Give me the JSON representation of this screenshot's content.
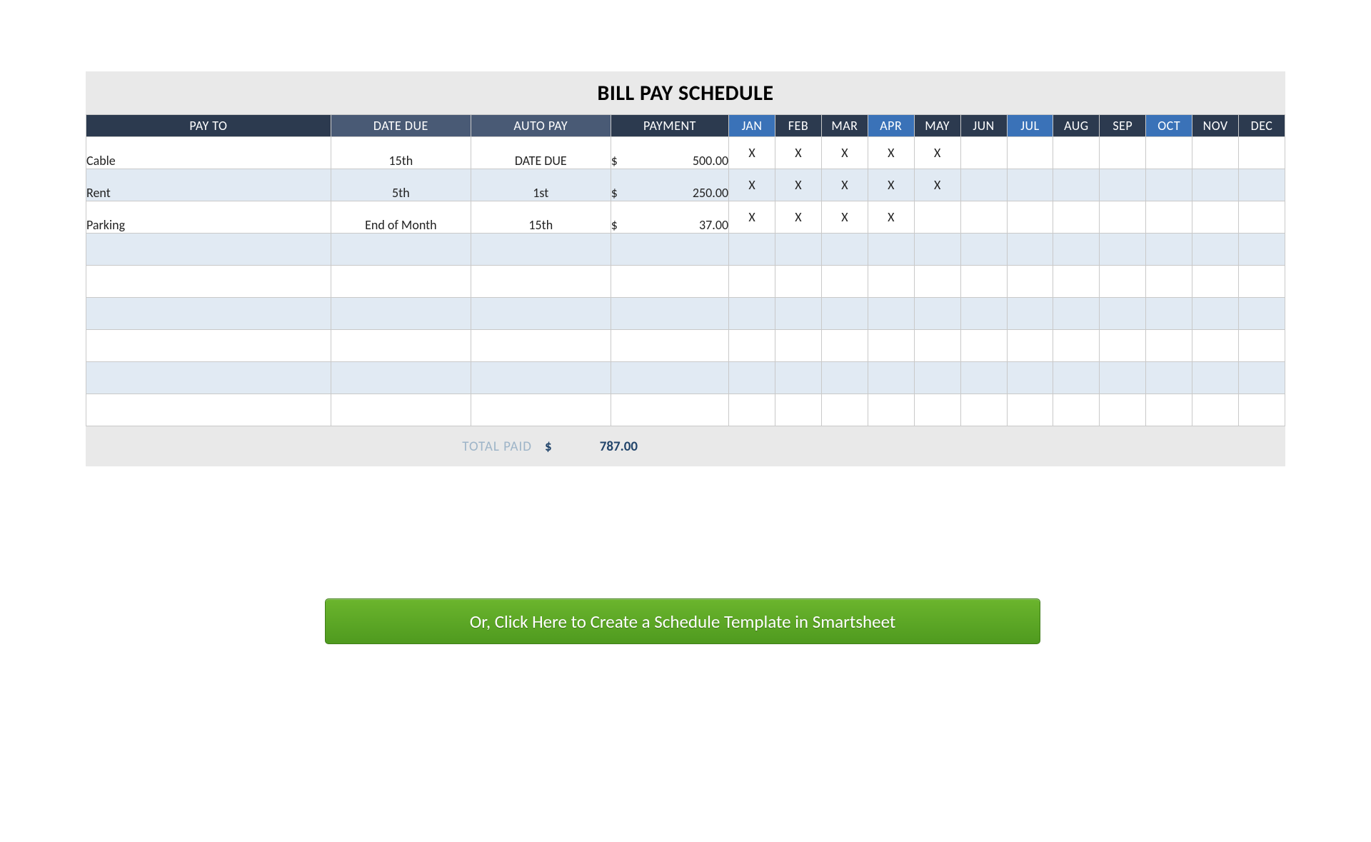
{
  "title": "BILL PAY SCHEDULE",
  "headers": {
    "pay_to": "PAY TO",
    "date_due": "DATE DUE",
    "auto_pay": "AUTO PAY",
    "payment": "PAYMENT"
  },
  "months": [
    "JAN",
    "FEB",
    "MAR",
    "APR",
    "MAY",
    "JUN",
    "JUL",
    "AUG",
    "SEP",
    "OCT",
    "NOV",
    "DEC"
  ],
  "month_colors": [
    "blue",
    "dark2",
    "dark2",
    "blue",
    "dark2",
    "dark2",
    "blue",
    "dark2",
    "dark2",
    "blue",
    "dark2",
    "dark2"
  ],
  "currency": "$",
  "mark": "X",
  "rows": [
    {
      "pay_to": "Cable",
      "date_due": "15th",
      "auto_pay": "DATE DUE",
      "payment": "500.00",
      "marks": [
        true,
        true,
        true,
        true,
        true,
        false,
        false,
        false,
        false,
        false,
        false,
        false
      ]
    },
    {
      "pay_to": "Rent",
      "date_due": "5th",
      "auto_pay": "1st",
      "payment": "250.00",
      "marks": [
        true,
        true,
        true,
        true,
        true,
        false,
        false,
        false,
        false,
        false,
        false,
        false
      ]
    },
    {
      "pay_to": "Parking",
      "date_due": "End of Month",
      "auto_pay": "15th",
      "payment": "37.00",
      "marks": [
        true,
        true,
        true,
        true,
        false,
        false,
        false,
        false,
        false,
        false,
        false,
        false
      ]
    },
    {
      "pay_to": "",
      "date_due": "",
      "auto_pay": "",
      "payment": "",
      "marks": [
        false,
        false,
        false,
        false,
        false,
        false,
        false,
        false,
        false,
        false,
        false,
        false
      ]
    },
    {
      "pay_to": "",
      "date_due": "",
      "auto_pay": "",
      "payment": "",
      "marks": [
        false,
        false,
        false,
        false,
        false,
        false,
        false,
        false,
        false,
        false,
        false,
        false
      ]
    },
    {
      "pay_to": "",
      "date_due": "",
      "auto_pay": "",
      "payment": "",
      "marks": [
        false,
        false,
        false,
        false,
        false,
        false,
        false,
        false,
        false,
        false,
        false,
        false
      ]
    },
    {
      "pay_to": "",
      "date_due": "",
      "auto_pay": "",
      "payment": "",
      "marks": [
        false,
        false,
        false,
        false,
        false,
        false,
        false,
        false,
        false,
        false,
        false,
        false
      ]
    },
    {
      "pay_to": "",
      "date_due": "",
      "auto_pay": "",
      "payment": "",
      "marks": [
        false,
        false,
        false,
        false,
        false,
        false,
        false,
        false,
        false,
        false,
        false,
        false
      ]
    },
    {
      "pay_to": "",
      "date_due": "",
      "auto_pay": "",
      "payment": "",
      "marks": [
        false,
        false,
        false,
        false,
        false,
        false,
        false,
        false,
        false,
        false,
        false,
        false
      ]
    }
  ],
  "footer": {
    "label": "TOTAL PAID",
    "amount": "787.00"
  },
  "cta": "Or, Click Here to Create a Schedule Template in Smartsheet"
}
